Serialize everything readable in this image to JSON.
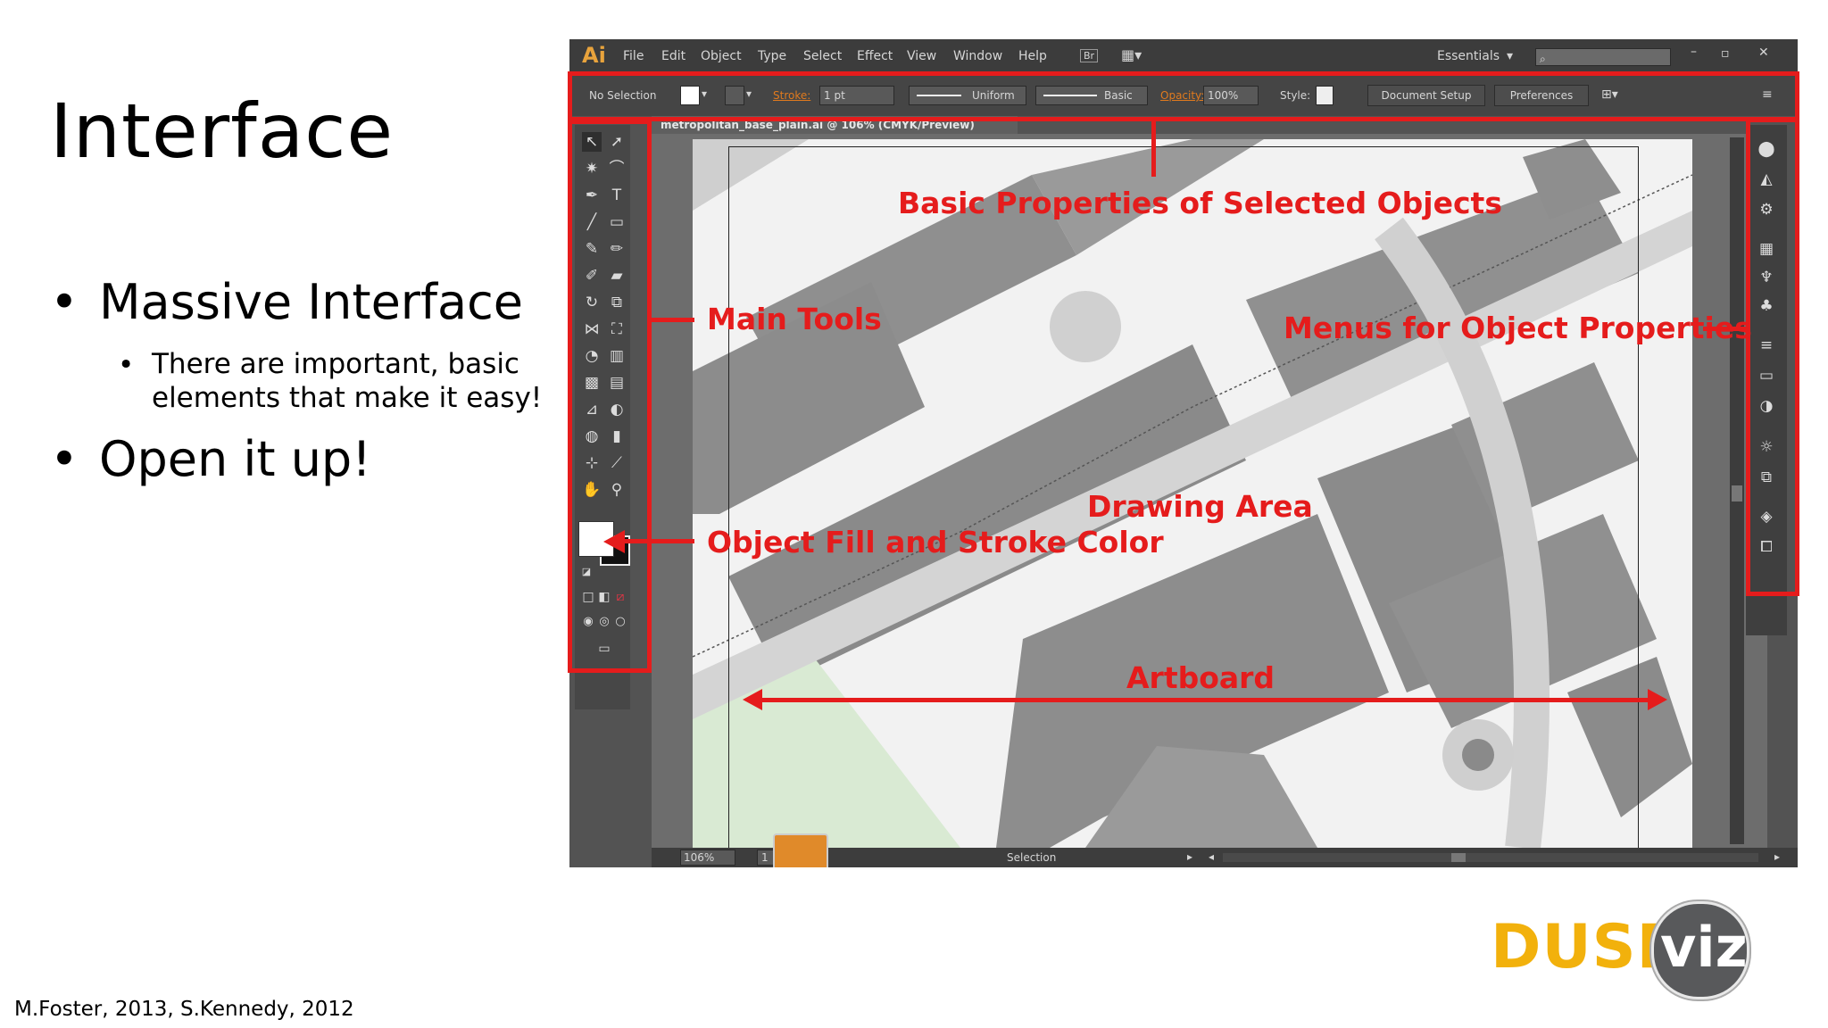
{
  "slide": {
    "title": "Interface",
    "bullets": [
      {
        "text": "Massive Interface",
        "sub": [
          "There are important, basic",
          "elements that make it easy!"
        ]
      },
      {
        "text": "Open it up!"
      }
    ],
    "credit": "M.Foster, 2013, S.Kennedy, 2012",
    "logo": {
      "dusp": "DUSP",
      "viz": "viz"
    }
  },
  "app": {
    "logo": "Ai",
    "menus": [
      "File",
      "Edit",
      "Object",
      "Type",
      "Select",
      "Effect",
      "View",
      "Window",
      "Help"
    ],
    "bridge_badge": "Br",
    "workspace": "Essentials",
    "options": {
      "selection": "No Selection",
      "stroke_label": "Stroke:",
      "stroke_weight": "1 pt",
      "profile": "Uniform",
      "brush": "Basic",
      "opacity_label": "Opacity:",
      "opacity_value": "100%",
      "style_label": "Style:",
      "document_setup": "Document Setup",
      "preferences": "Preferences"
    },
    "doc_tab": "metropolitan_base_plain.ai @ 106% (CMYK/Preview)",
    "status": {
      "zoom": "106%",
      "page": "1",
      "mode": "Selection"
    }
  },
  "annotations": {
    "basic_properties": "Basic Properties of Selected Objects",
    "main_tools": "Main Tools",
    "menus_properties": "Menus for Object Properties",
    "drawing_area": "Drawing Area",
    "fill_stroke": "Object Fill and Stroke Color",
    "artboard": "Artboard"
  },
  "colors": {
    "annotation": "#e51c1c",
    "dusp": "#f2b10c",
    "viz_circle": "#58595b"
  }
}
